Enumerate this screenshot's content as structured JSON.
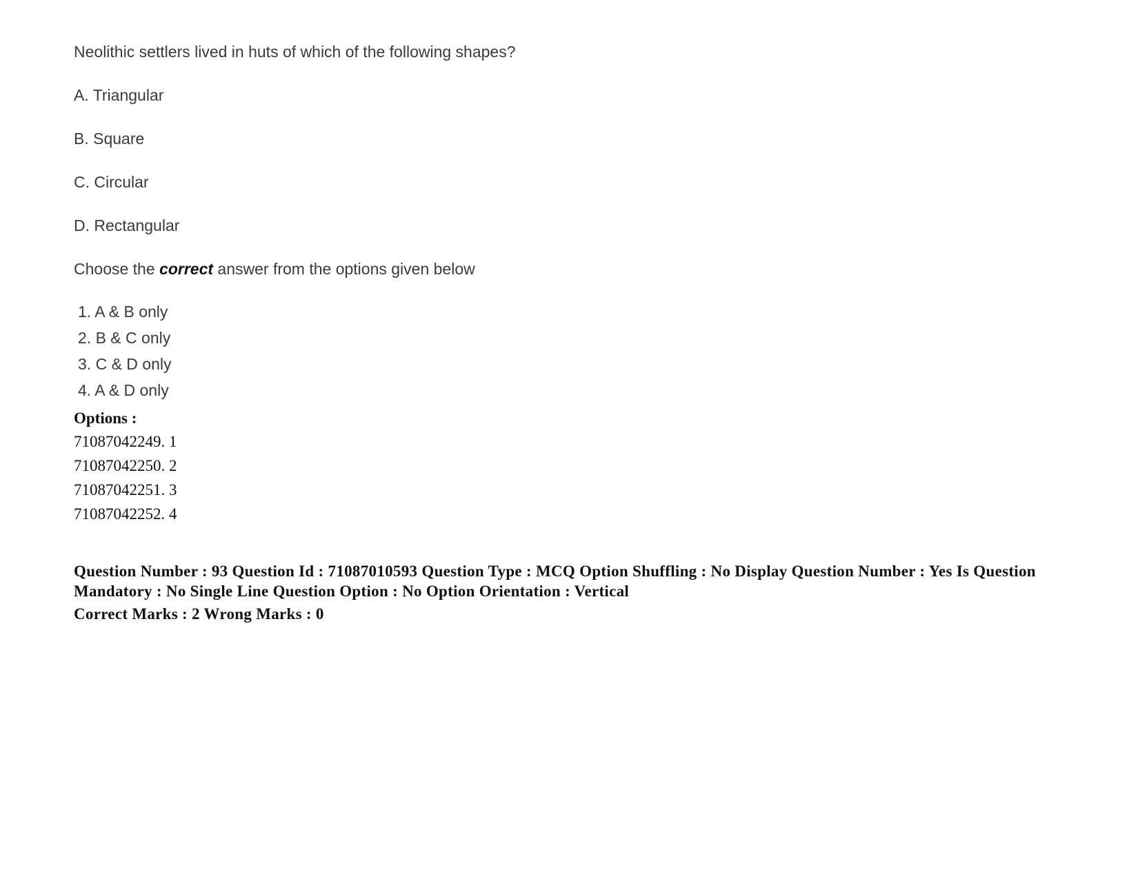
{
  "question": {
    "stem": "Neolithic settlers lived in huts of which of the following shapes?",
    "statements": [
      "A. Triangular",
      "B. Square",
      "C. Circular",
      "D. Rectangular"
    ],
    "instruction_prefix": "Choose the ",
    "instruction_emphasis": "correct",
    "instruction_suffix": " answer from the options given below",
    "choices": [
      "1. A & B only",
      "2. B & C only",
      "3. C & D only",
      "4. A & D only"
    ]
  },
  "options": {
    "heading": "Options :",
    "items": [
      "71087042249. 1",
      "71087042250. 2",
      "71087042251. 3",
      "71087042252. 4"
    ]
  },
  "meta": {
    "line1": "Question Number : 93 Question Id : 71087010593 Question Type : MCQ Option Shuffling : No Display Question Number : Yes Is Question Mandatory : No Single Line Question Option : No Option Orientation : Vertical",
    "marks": "Correct Marks : 2 Wrong Marks : 0"
  }
}
